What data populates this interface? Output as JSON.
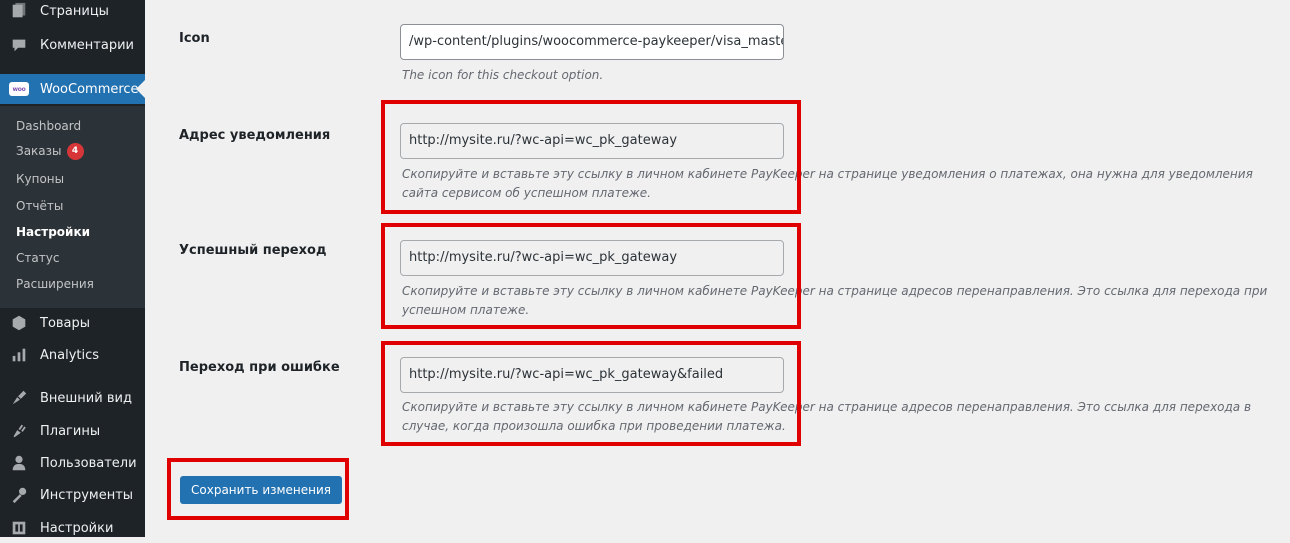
{
  "sidebar": {
    "top_items": [
      {
        "label": "Страницы",
        "icon": "pages-icon"
      },
      {
        "label": "Комментарии",
        "icon": "comments-icon"
      }
    ],
    "woocommerce": {
      "label": "WooCommerce",
      "icon_text": "woo"
    },
    "submenu": [
      {
        "label": "Dashboard"
      },
      {
        "label": "Заказы",
        "badge": "4"
      },
      {
        "label": "Купоны"
      },
      {
        "label": "Отчёты"
      },
      {
        "label": "Настройки",
        "current": true
      },
      {
        "label": "Статус"
      },
      {
        "label": "Расширения"
      }
    ],
    "bottom_items": [
      {
        "label": "Товары",
        "icon": "products-icon"
      },
      {
        "label": "Analytics",
        "icon": "analytics-icon"
      },
      {
        "label": "Внешний вид",
        "icon": "appearance-icon"
      },
      {
        "label": "Плагины",
        "icon": "plugins-icon"
      },
      {
        "label": "Пользователи",
        "icon": "users-icon"
      },
      {
        "label": "Инструменты",
        "icon": "tools-icon"
      },
      {
        "label": "Настройки",
        "icon": "settings-icon"
      }
    ]
  },
  "form": {
    "icon_row": {
      "label": "Icon",
      "value": "/wp-content/plugins/woocommerce-paykeeper/visa_masterc",
      "description": "The icon for this checkout option."
    },
    "notify_row": {
      "label": "Адрес уведомления",
      "value": "http://mysite.ru/?wc-api=wc_pk_gateway",
      "description_line1": "Скопируйте и вставьте эту ссылку в личном кабинете PayKeeper на странице уведомления о платежах, она нужна для уведомления",
      "description_line2": "сайта сервисом об успешном платеже."
    },
    "success_row": {
      "label": "Успешный переход",
      "value": "http://mysite.ru/?wc-api=wc_pk_gateway",
      "description_line1": "Скопируйте и вставьте эту ссылку в личном кабинете PayKeeper на странице адресов перенаправления. Это ссылка для перехода при",
      "description_line2": "успешном платеже."
    },
    "fail_row": {
      "label": "Переход при ошибке",
      "value": "http://mysite.ru/?wc-api=wc_pk_gateway&failed",
      "description_line1": "Скопируйте и вставьте эту ссылку в личном кабинете PayKeeper на странице адресов перенаправления. Это ссылка для перехода в",
      "description_line2": "случае, когда произошла ошибка при проведении платежа."
    },
    "save_label": "Сохранить изменения"
  },
  "colors": {
    "sidebar_bg": "#1d2327",
    "active_bg": "#2271b1",
    "highlight": "#e00000",
    "badge": "#d63638"
  }
}
